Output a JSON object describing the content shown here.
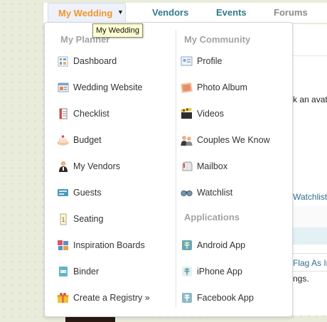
{
  "nav": {
    "my_wedding": "My Wedding",
    "vendors": "Vendors",
    "events": "Events",
    "forums": "Forums",
    "tooltip": "My Wedding"
  },
  "colors": {
    "active_nav": "#f0952a",
    "nav_link": "#2f7a8c",
    "nav_muted": "#8c8c8c",
    "section_title": "#a3a3a3"
  },
  "planner": {
    "title": "My Planner",
    "items": [
      {
        "label": "Dashboard",
        "icon": "dashboard-icon"
      },
      {
        "label": "Wedding Website",
        "icon": "website-icon"
      },
      {
        "label": "Checklist",
        "icon": "checklist-icon"
      },
      {
        "label": "Budget",
        "icon": "budget-cake-icon"
      },
      {
        "label": "My Vendors",
        "icon": "vendor-person-icon"
      },
      {
        "label": "Guests",
        "icon": "guests-icon"
      },
      {
        "label": "Seating",
        "icon": "seating-icon"
      },
      {
        "label": "Inspiration Boards",
        "icon": "inspiration-boards-icon"
      },
      {
        "label": "Binder",
        "icon": "binder-icon"
      },
      {
        "label": "Create a Registry »",
        "icon": "registry-gift-icon"
      }
    ]
  },
  "community": {
    "title": "My Community",
    "items": [
      {
        "label": "Profile",
        "icon": "profile-card-icon"
      },
      {
        "label": "Photo Album",
        "icon": "photo-album-icon"
      },
      {
        "label": "Videos",
        "icon": "clapperboard-icon"
      },
      {
        "label": "Couples We Know",
        "icon": "couples-icon"
      },
      {
        "label": "Mailbox",
        "icon": "mailbox-icon"
      },
      {
        "label": "Watchlist",
        "icon": "binoculars-icon"
      }
    ]
  },
  "applications": {
    "title": "Applications",
    "items": [
      {
        "label": "Android App",
        "icon": "android-app-icon"
      },
      {
        "label": "iPhone App",
        "icon": "iphone-app-icon"
      },
      {
        "label": "Facebook App",
        "icon": "facebook-app-icon"
      }
    ]
  },
  "background": {
    "avatar_text": "k an avat",
    "watchlist_link": "Watchlist",
    "flag_link": "Flag As In",
    "ngs_text": "ngs."
  }
}
